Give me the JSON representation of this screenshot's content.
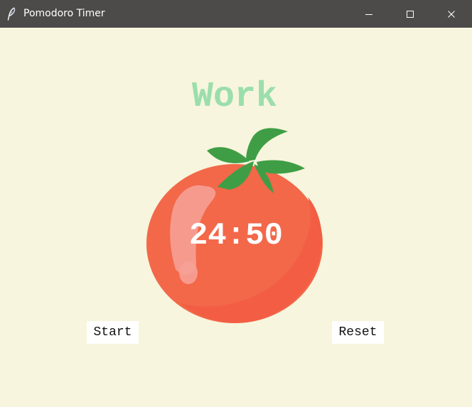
{
  "window": {
    "title": "Pomodoro Timer",
    "app_icon": "feather-icon",
    "controls": [
      {
        "name": "minimize",
        "icon": "minimize-icon"
      },
      {
        "name": "maximize",
        "icon": "maximize-icon"
      },
      {
        "name": "close",
        "icon": "close-icon"
      }
    ]
  },
  "main": {
    "mode": "Work",
    "timer": "24:50",
    "buttons": {
      "start": "Start",
      "reset": "Reset"
    },
    "image": "tomato"
  },
  "colors": {
    "background": "#f7f5dd",
    "titlebar": "#4d4b4a",
    "mode_text": "#9bdeac",
    "tomato": "#f26849",
    "tomato_shadow": "#f25d44",
    "leaf": "#3f9e45",
    "timer_text": "#ffffff",
    "button_background": "#ffffff"
  }
}
